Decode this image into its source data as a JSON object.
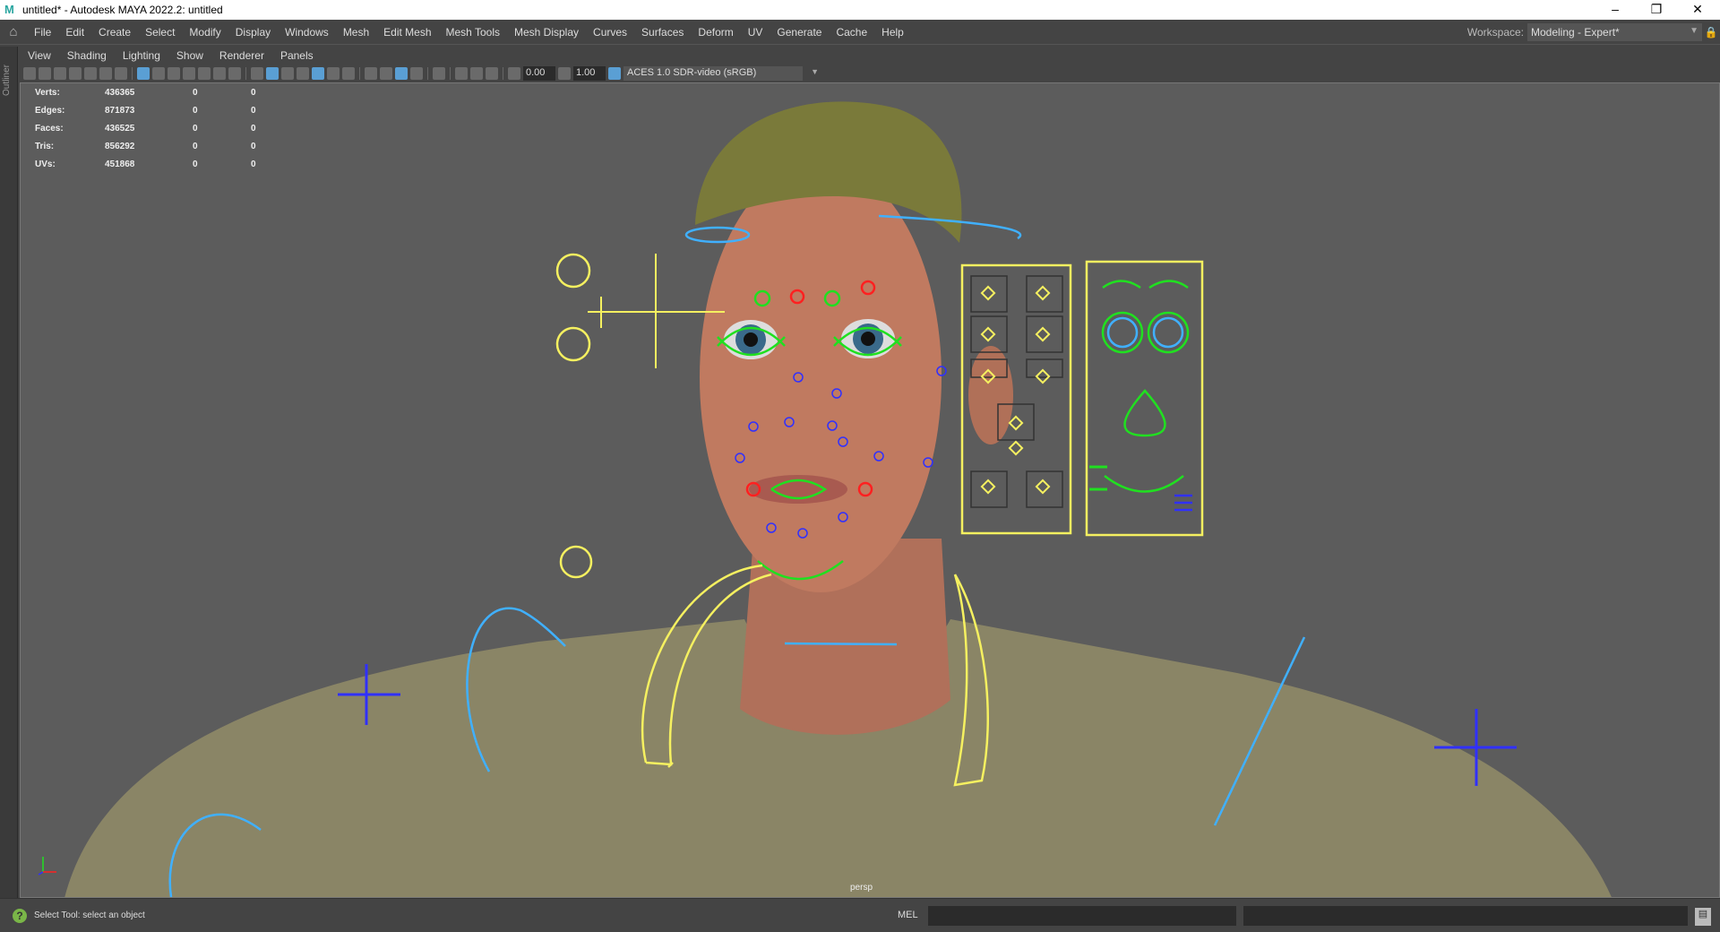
{
  "titlebar": {
    "title": "untitled* - Autodesk MAYA 2022.2: untitled",
    "logo": "M",
    "minimize": "–",
    "restore": "❐",
    "close": "✕"
  },
  "menubar": {
    "items": [
      "File",
      "Edit",
      "Create",
      "Select",
      "Modify",
      "Display",
      "Windows",
      "Mesh",
      "Edit Mesh",
      "Mesh Tools",
      "Mesh Display",
      "Curves",
      "Surfaces",
      "Deform",
      "UV",
      "Generate",
      "Cache",
      "Help"
    ],
    "workspace_label": "Workspace:",
    "workspace_value": "Modeling - Expert*"
  },
  "outliner": {
    "label": "Outliner"
  },
  "panel_menu": [
    "View",
    "Shading",
    "Lighting",
    "Show",
    "Renderer",
    "Panels"
  ],
  "toolbar": {
    "exposure": "0.00",
    "gamma": "1.00",
    "color_space": "ACES 1.0 SDR-video (sRGB)"
  },
  "hud": {
    "rows": [
      {
        "label": "Verts:",
        "value": "436365",
        "a": "0",
        "b": "0"
      },
      {
        "label": "Edges:",
        "value": "871873",
        "a": "0",
        "b": "0"
      },
      {
        "label": "Faces:",
        "value": "436525",
        "a": "0",
        "b": "0"
      },
      {
        "label": "Tris:",
        "value": "856292",
        "a": "0",
        "b": "0"
      },
      {
        "label": "UVs:",
        "value": "451868",
        "a": "0",
        "b": "0"
      }
    ]
  },
  "viewport": {
    "camera": "persp"
  },
  "statusbar": {
    "message": "Select Tool: select an object",
    "mel_label": "MEL"
  },
  "colors": {
    "ctrl_yellow": "#f5f060",
    "ctrl_green": "#20e020",
    "ctrl_blue": "#3030ff",
    "ctrl_cyan": "#40b0ff",
    "ctrl_red": "#ff2020"
  }
}
